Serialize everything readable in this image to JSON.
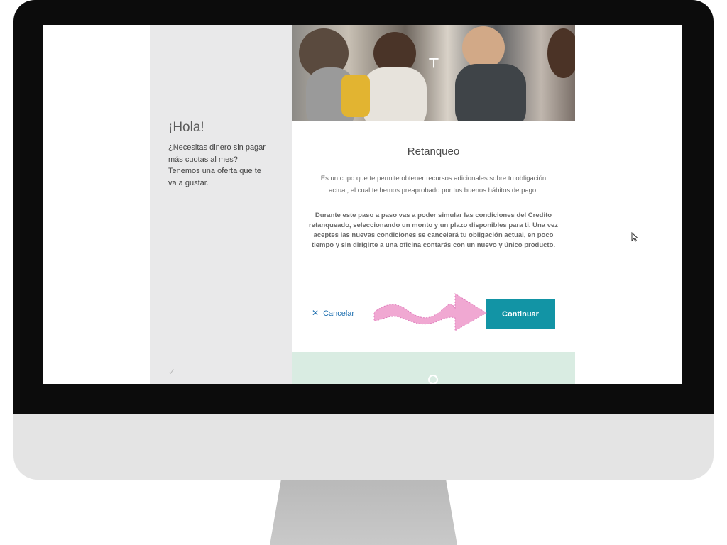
{
  "left_panel": {
    "greeting": "¡Hola!",
    "message": "¿Necesitas dinero sin pagar más cuotas al mes? Tenemos una oferta que te va a gustar.",
    "check_icon": "check-icon"
  },
  "card": {
    "title": "Retanqueo",
    "paragraph1": "Es un cupo que te permite obtener recursos adicionales sobre tu obligación actual, el cual te hemos preaprobado por tus buenos hábitos de pago.",
    "paragraph2": "Durante este paso a paso vas a poder simular las condiciones del Credito retanqueado, seleccionando un monto y un plazo disponibles para ti. Una vez aceptes las nuevas condiciones se cancelará tu obligación actual, en poco tiempo y sin dirigirte a una oficina contarás con un nuevo y único producto.",
    "cancel_label": "Cancelar",
    "continue_label": "Continuar",
    "logo_icon": "bank-logo-icon"
  },
  "colors": {
    "primary_button": "#1294a5",
    "cancel_link": "#1d6fb0",
    "annotation_arrow": "#f0a8d2",
    "info_strip": "#d9ece2",
    "side_panel": "#e9e9ea",
    "bezel": "#0c0c0c"
  }
}
